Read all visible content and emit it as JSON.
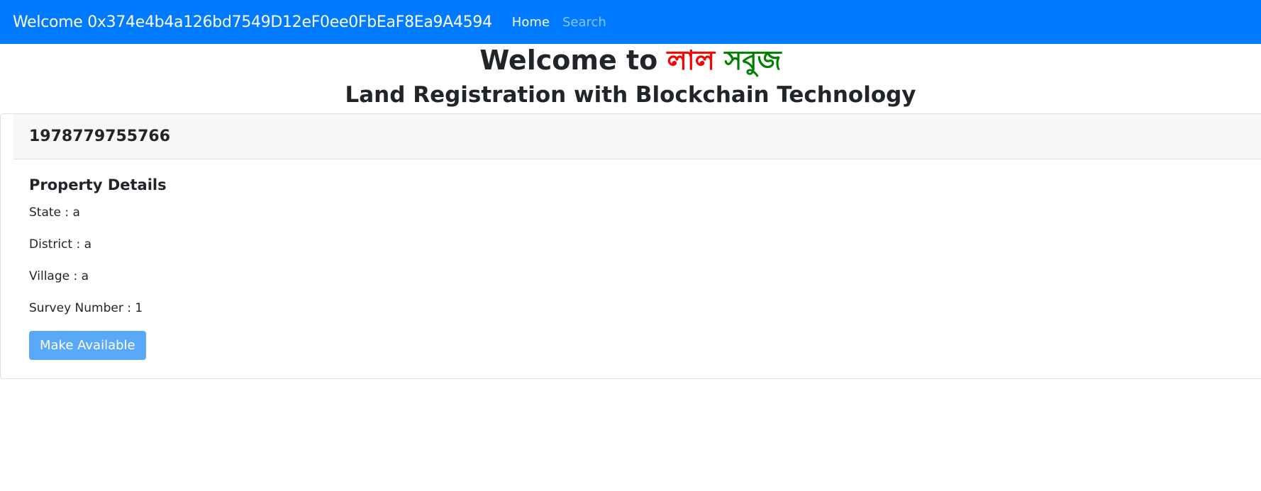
{
  "navbar": {
    "brand": "Welcome 0x374e4b4a126bd7549D12eF0ee0FbEaF8Ea9A4594",
    "links": [
      {
        "label": "Home",
        "active": true
      },
      {
        "label": "Search",
        "active": false
      }
    ]
  },
  "hero": {
    "title_prefix": "Welcome to",
    "title_red": "লাল",
    "title_green": "সবুজ",
    "subtitle": "Land Registration with Blockchain Technology"
  },
  "card": {
    "header": "1978779755766",
    "details_title": "Property Details",
    "details": [
      "State : a",
      "District : a",
      "Village : a",
      "Survey Number : 1"
    ],
    "button_label": "Make Available"
  },
  "colors": {
    "navbar": "#007bff",
    "title_red": "#ff0000",
    "title_green": "#008000",
    "button": "#5aa9f8"
  }
}
